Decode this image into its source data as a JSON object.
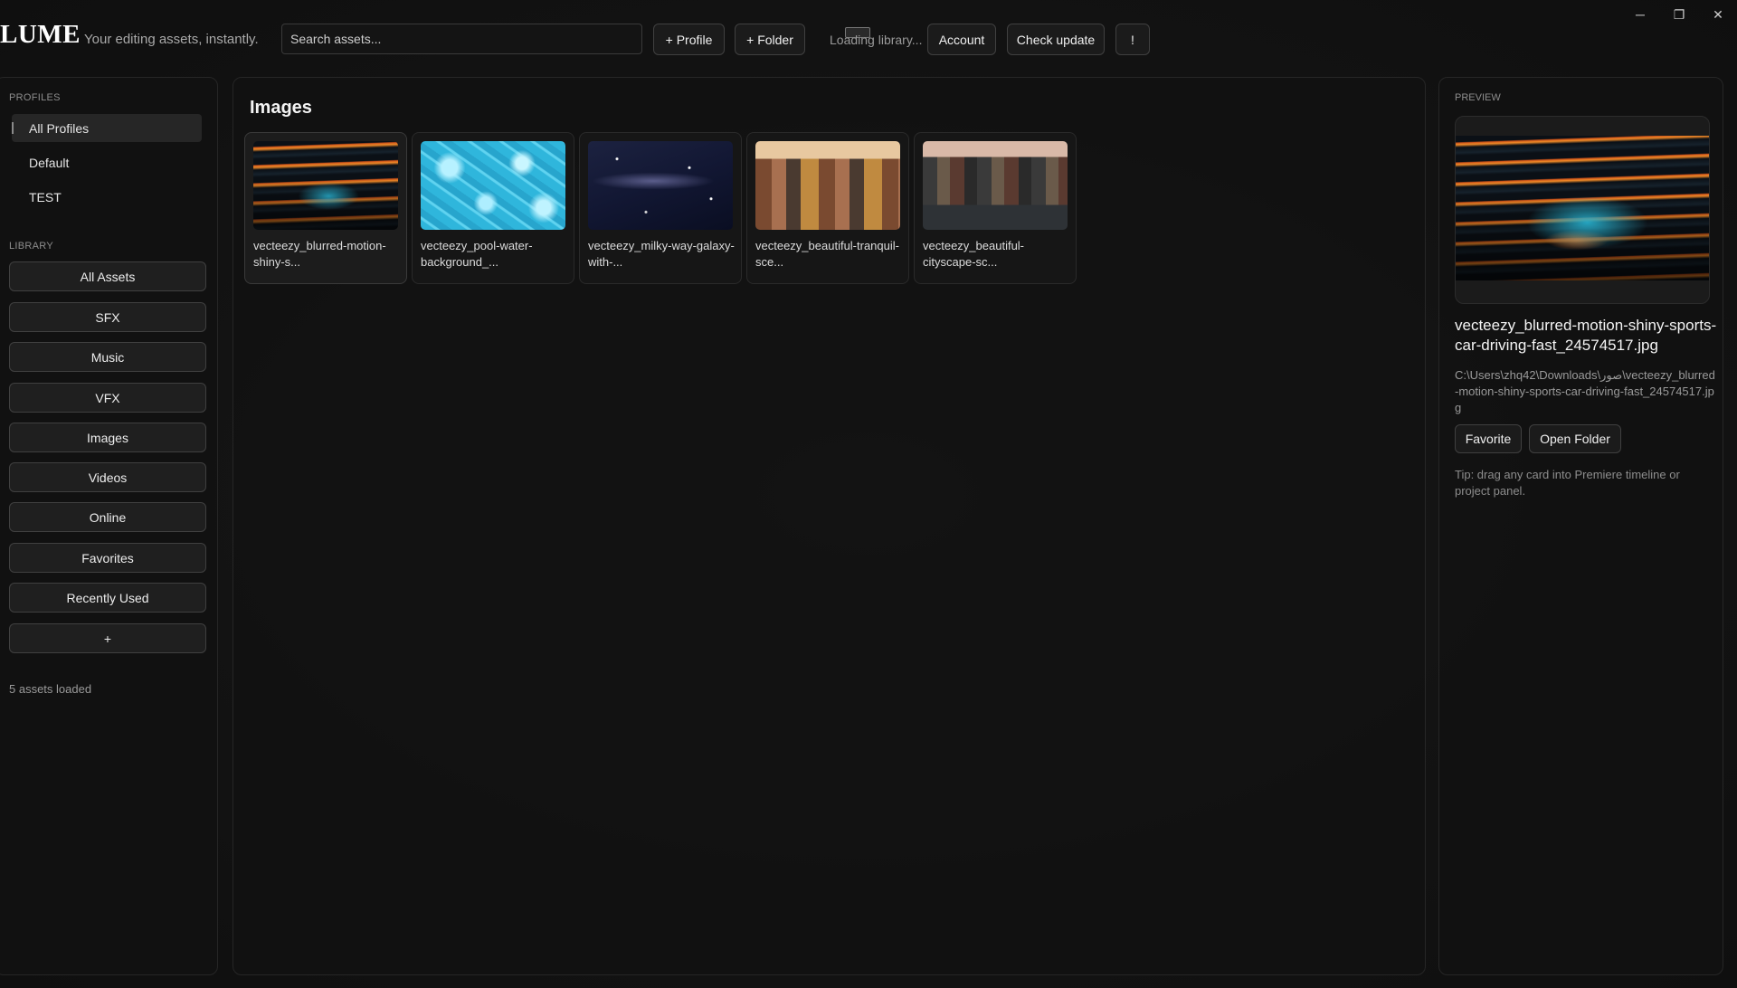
{
  "app": {
    "brand": "LUME",
    "tagline": "Your editing assets, instantly."
  },
  "toolbar": {
    "search_placeholder": "Search assets...",
    "profile_button": "+ Profile",
    "folder_button": "+ Folder",
    "status": "Loading library...",
    "account_button": "Account",
    "check_update_button": "Check update",
    "alert_button": "!"
  },
  "window_controls": {
    "minimize": "─",
    "restore": "❐",
    "close": "✕"
  },
  "sidebar": {
    "profiles_label": "PROFILES",
    "profiles": [
      "All Profiles",
      "Default",
      "TEST"
    ],
    "library_label": "LIBRARY",
    "library": [
      "All Assets",
      "SFX",
      "Music",
      "VFX",
      "Images",
      "Videos",
      "Online",
      "Favorites",
      "Recently Used",
      "+"
    ],
    "assets_count": "5 assets loaded"
  },
  "main": {
    "title": "Images",
    "cards": [
      {
        "name": "vecteezy_blurred-motion-shiny-s...",
        "thumb": "race-car-thumbnail"
      },
      {
        "name": "vecteezy_pool-water-background_...",
        "thumb": "pool-water-thumbnail"
      },
      {
        "name": "vecteezy_milky-way-galaxy-with-...",
        "thumb": "galaxy-thumbnail"
      },
      {
        "name": "vecteezy_beautiful-tranquil-sce...",
        "thumb": "canal-houses-thumbnail"
      },
      {
        "name": "vecteezy_beautiful-cityscape-sc...",
        "thumb": "cityscape-thumbnail"
      }
    ]
  },
  "preview": {
    "label": "PREVIEW",
    "filename": "vecteezy_blurred-motion-shiny-sports-car-driving-fast_24574517.jpg",
    "path": "C:\\Users\\zhq42\\Downloads\\صور\\vecteezy_blurred-motion-shiny-sports-car-driving-fast_24574517.jpg",
    "favorite_button": "Favorite",
    "open_folder_button": "Open Folder",
    "tip": "Tip: drag any card into Premiere timeline or project panel."
  }
}
